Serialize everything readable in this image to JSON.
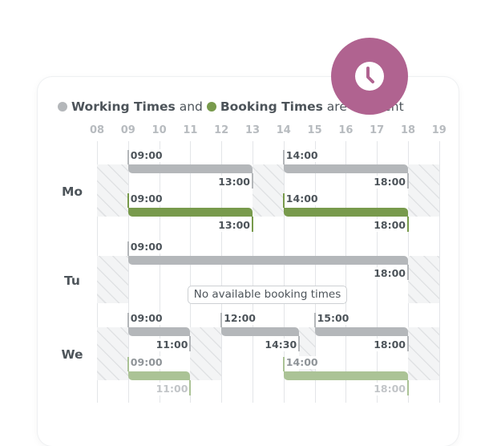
{
  "legend": {
    "working_label": "Working Times",
    "and_text": "and",
    "booking_label": "Booking Times",
    "are_text": "are",
    "different_text": "different",
    "working_color": "#b4b7ba",
    "booking_color": "#789a4c"
  },
  "badge": {
    "icon": "clock-icon",
    "color": "#b06390"
  },
  "hours": [
    "08",
    "09",
    "10",
    "11",
    "12",
    "13",
    "14",
    "15",
    "16",
    "17",
    "18",
    "19"
  ],
  "days": [
    {
      "label": "Mo",
      "working": [
        {
          "start": "09:00",
          "end": "13:00"
        },
        {
          "start": "14:00",
          "end": "18:00"
        }
      ],
      "booking": [
        {
          "start": "09:00",
          "end": "13:00"
        },
        {
          "start": "14:00",
          "end": "18:00"
        }
      ],
      "booking_style": "solid"
    },
    {
      "label": "Tu",
      "working": [
        {
          "start": "09:00",
          "end": "18:00"
        }
      ],
      "booking": [],
      "no_booking_text": "No available booking times"
    },
    {
      "label": "We",
      "working": [
        {
          "start": "09:00",
          "end": "11:00"
        },
        {
          "start": "12:00",
          "end": "14:30"
        },
        {
          "start": "15:00",
          "end": "18:00"
        }
      ],
      "booking": [
        {
          "start": "09:00",
          "end": "11:00"
        },
        {
          "start": "14:00",
          "end": "18:00"
        }
      ],
      "booking_style": "light"
    }
  ]
}
